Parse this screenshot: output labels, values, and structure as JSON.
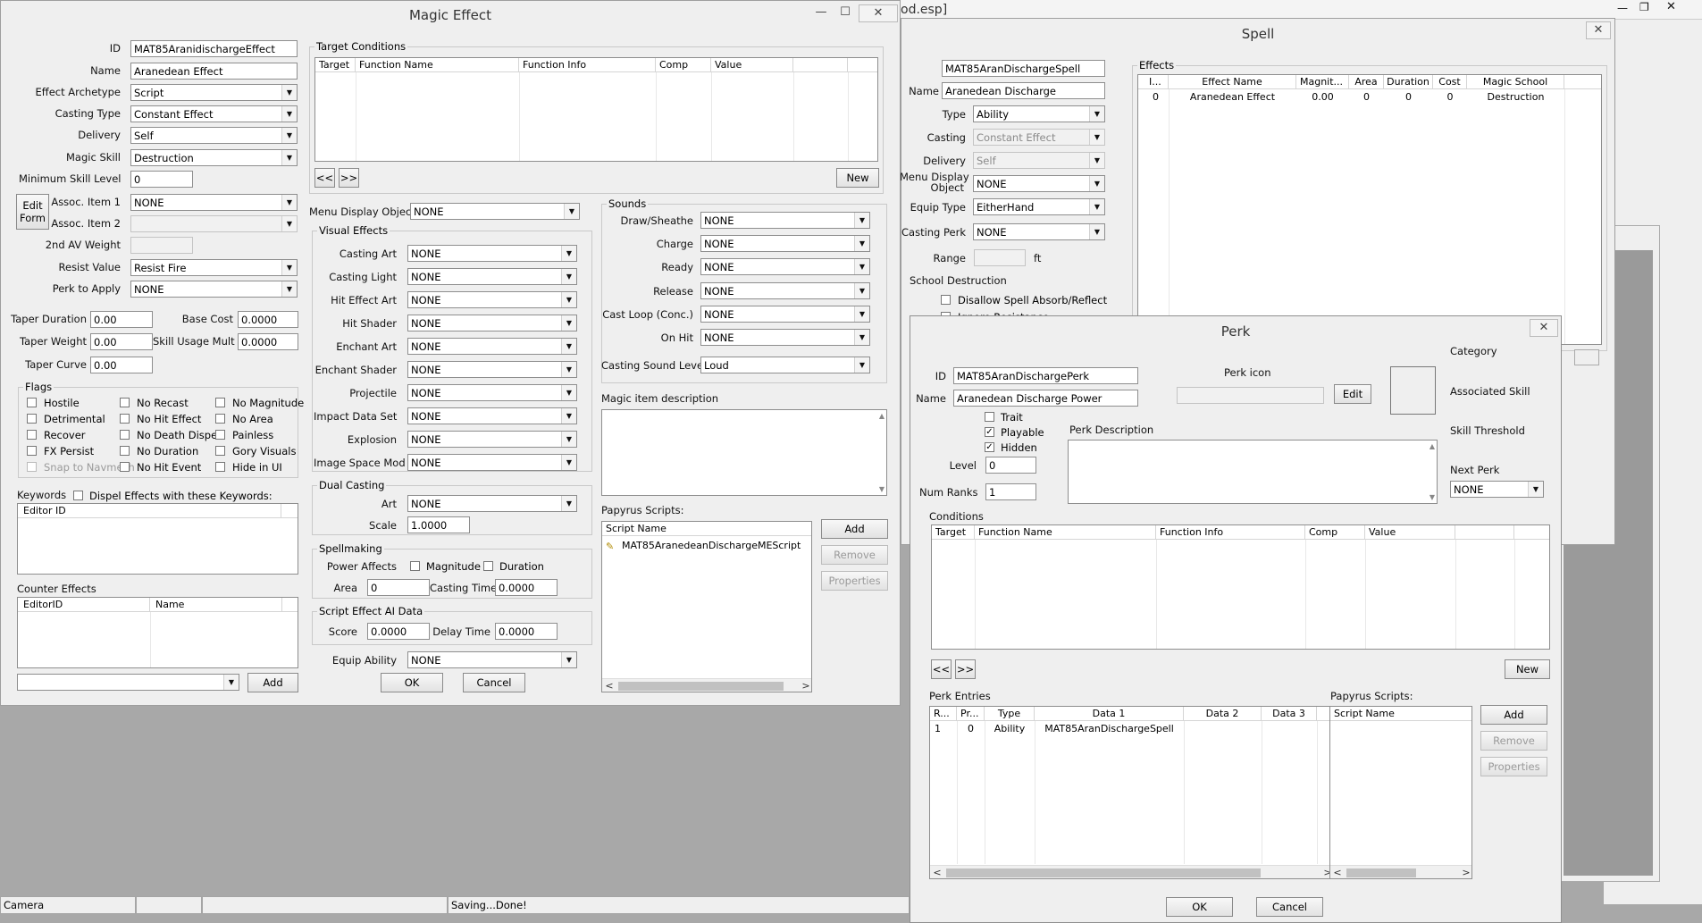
{
  "background_window": {
    "title_fragment": "od.esp]"
  },
  "magic_effect": {
    "title": "Magic Effect",
    "minimize": "—",
    "maximize": "☐",
    "close": "✕",
    "fields": {
      "id_label": "ID",
      "id_value": "MAT85AranidischargeEffect",
      "name_label": "Name",
      "name_value": "Aranedean Effect",
      "archetype_label": "Effect Archetype",
      "archetype_value": "Script",
      "casting_type_label": "Casting Type",
      "casting_type_value": "Constant Effect",
      "delivery_label": "Delivery",
      "delivery_value": "Self",
      "magic_skill_label": "Magic Skill",
      "magic_skill_value": "Destruction",
      "min_skill_label": "Minimum Skill Level",
      "min_skill_value": "0",
      "edit_form_btn": "Edit Form",
      "assoc1_label": "Assoc. Item 1",
      "assoc1_value": "NONE",
      "assoc2_label": "Assoc. Item 2",
      "assoc2_value": "",
      "second_av_label": "2nd AV Weight",
      "second_av_value": "",
      "resist_label": "Resist Value",
      "resist_value": "Resist Fire",
      "perk_label": "Perk to Apply",
      "perk_value": "NONE",
      "taper_duration_label": "Taper Duration",
      "taper_duration_value": "0.00",
      "base_cost_label": "Base Cost",
      "base_cost_value": "0.0000",
      "taper_weight_label": "Taper Weight",
      "taper_weight_value": "0.00",
      "skill_usage_label": "Skill Usage Mult",
      "skill_usage_value": "0.0000",
      "taper_curve_label": "Taper Curve",
      "taper_curve_value": "0.00"
    },
    "flags": {
      "label": "Flags",
      "items": [
        {
          "label": "Hostile",
          "checked": false,
          "disabled": false
        },
        {
          "label": "No Recast",
          "checked": false,
          "disabled": false
        },
        {
          "label": "No Magnitude",
          "checked": false,
          "disabled": false
        },
        {
          "label": "Detrimental",
          "checked": false,
          "disabled": false
        },
        {
          "label": "No Hit Effect",
          "checked": false,
          "disabled": false
        },
        {
          "label": "No Area",
          "checked": false,
          "disabled": false
        },
        {
          "label": "Recover",
          "checked": false,
          "disabled": false
        },
        {
          "label": "No Death Dispel",
          "checked": false,
          "disabled": false
        },
        {
          "label": "Painless",
          "checked": false,
          "disabled": false
        },
        {
          "label": "FX Persist",
          "checked": false,
          "disabled": false
        },
        {
          "label": "No Duration",
          "checked": false,
          "disabled": false
        },
        {
          "label": "Gory Visuals",
          "checked": false,
          "disabled": false
        },
        {
          "label": "Snap to Navmesh",
          "checked": false,
          "disabled": true
        },
        {
          "label": "No Hit Event",
          "checked": false,
          "disabled": false
        },
        {
          "label": "Hide in UI",
          "checked": false,
          "disabled": false
        }
      ]
    },
    "keywords": {
      "label": "Keywords",
      "dispel_label": "Dispel Effects with these Keywords:",
      "header": "Editor ID"
    },
    "counter": {
      "label": "Counter Effects",
      "headers": [
        "EditorID",
        "Name"
      ],
      "add_btn": "Add",
      "select_value": ""
    },
    "target_conditions": {
      "label": "Target Conditions",
      "headers": [
        "Target",
        "Function Name",
        "Function Info",
        "Comp",
        "Value",
        ""
      ],
      "prev": "<<",
      "next": ">>",
      "new_btn": "New"
    },
    "menu_display": {
      "label": "Menu Display Object",
      "value": "NONE"
    },
    "visual": {
      "label": "Visual Effects",
      "rows": [
        {
          "label": "Casting Art",
          "value": "NONE"
        },
        {
          "label": "Casting Light",
          "value": "NONE"
        },
        {
          "label": "Hit Effect Art",
          "value": "NONE"
        },
        {
          "label": "Hit Shader",
          "value": "NONE"
        },
        {
          "label": "Enchant Art",
          "value": "NONE"
        },
        {
          "label": "Enchant Shader",
          "value": "NONE"
        },
        {
          "label": "Projectile",
          "value": "NONE"
        },
        {
          "label": "Impact Data Set",
          "value": "NONE"
        },
        {
          "label": "Explosion",
          "value": "NONE"
        },
        {
          "label": "Image Space Mod",
          "value": "NONE"
        }
      ]
    },
    "dual": {
      "label": "Dual Casting",
      "art_label": "Art",
      "art_value": "NONE",
      "scale_label": "Scale",
      "scale_value": "1.0000"
    },
    "spellmaking": {
      "label": "Spellmaking",
      "power_label": "Power Affects",
      "magnitude": "Magnitude",
      "duration": "Duration",
      "area_label": "Area",
      "area_value": "0",
      "casting_time_label": "Casting Time",
      "casting_time_value": "0.0000"
    },
    "ai": {
      "label": "Script Effect AI Data",
      "score_label": "Score",
      "score_value": "0.0000",
      "delay_label": "Delay Time",
      "delay_value": "0.0000"
    },
    "equip": {
      "label": "Equip Ability",
      "value": "NONE"
    },
    "ok": "OK",
    "cancel": "Cancel",
    "sounds": {
      "label": "Sounds",
      "rows": [
        {
          "label": "Draw/Sheathe",
          "value": "NONE"
        },
        {
          "label": "Charge",
          "value": "NONE"
        },
        {
          "label": "Ready",
          "value": "NONE"
        },
        {
          "label": "Release",
          "value": "NONE"
        },
        {
          "label": "Cast Loop (Conc.)",
          "value": "NONE"
        },
        {
          "label": "On Hit",
          "value": "NONE"
        }
      ],
      "level_label": "Casting Sound Level",
      "level_value": "Loud"
    },
    "description_label": "Magic item description",
    "papyrus": {
      "label": "Papyrus Scripts:",
      "header": "Script Name",
      "script": "MAT85AranedeanDischargeMEScript",
      "add": "Add",
      "remove": "Remove",
      "properties": "Properties"
    }
  },
  "spell": {
    "title": "Spell",
    "close": "✕",
    "id_label": "ID",
    "id_value": "MAT85AranDischargeSpell",
    "name_label": "Name",
    "name_value": "Aranedean Discharge",
    "type_label": "Type",
    "type_value": "Ability",
    "casting_label": "Casting",
    "casting_value": "Constant Effect",
    "delivery_label": "Delivery",
    "delivery_value": "Self",
    "menu_label_1": "Menu Display",
    "menu_label_2": "Object",
    "menu_value": "NONE",
    "equip_label": "Equip Type",
    "equip_value": "EitherHand",
    "perk_label": "Casting Perk",
    "perk_value": "NONE",
    "range_label": "Range",
    "range_unit": "ft",
    "school_label": "School",
    "school_value": "Destruction",
    "disallow_label": "Disallow Spell Absorb/Reflect",
    "ignore_label": "Ignore Resistance",
    "effects": {
      "label": "Effects",
      "headers": [
        "I...",
        "Effect Name",
        "Magnit...",
        "Area",
        "Duration",
        "Cost",
        "Magic School"
      ],
      "rows": [
        [
          "0",
          "Aranedean Effect",
          "0.00",
          "0",
          "0",
          "0",
          "Destruction"
        ]
      ]
    }
  },
  "perk": {
    "title": "Perk",
    "close": "✕",
    "id_label": "ID",
    "id_value": "MAT85AranDischargePerk",
    "name_label": "Name",
    "name_value": "Aranedean Discharge Power",
    "icon_label": "Perk icon",
    "edit_btn": "Edit",
    "category_label": "Category",
    "assoc_skill_label": "Associated Skill",
    "skill_threshold_label": "Skill Threshold",
    "next_perk_label": "Next Perk",
    "next_perk_value": "NONE",
    "trait": "Trait",
    "playable": "Playable",
    "hidden": "Hidden",
    "desc_label": "Perk Description",
    "level_label": "Level",
    "level_value": "0",
    "ranks_label": "Num Ranks",
    "ranks_value": "1",
    "conditions": {
      "label": "Conditions",
      "headers": [
        "Target",
        "Function Name",
        "Function Info",
        "Comp",
        "Value",
        "",
        ""
      ],
      "prev": "<<",
      "next": ">>",
      "new_btn": "New"
    },
    "entries": {
      "label": "Perk Entries",
      "headers": [
        "R...",
        "Pr...",
        "Type",
        "Data 1",
        "Data 2",
        "Data 3"
      ],
      "rows": [
        [
          "1",
          "0",
          "Ability",
          "MAT85AranDischargeSpell",
          "",
          ""
        ]
      ]
    },
    "papyrus": {
      "label": "Papyrus Scripts:",
      "header": "Script Name",
      "add": "Add",
      "remove": "Remove",
      "properties": "Properties"
    },
    "ok": "OK",
    "cancel": "Cancel"
  },
  "statusbar": {
    "camera": "Camera",
    "message": "Saving...Done!"
  }
}
